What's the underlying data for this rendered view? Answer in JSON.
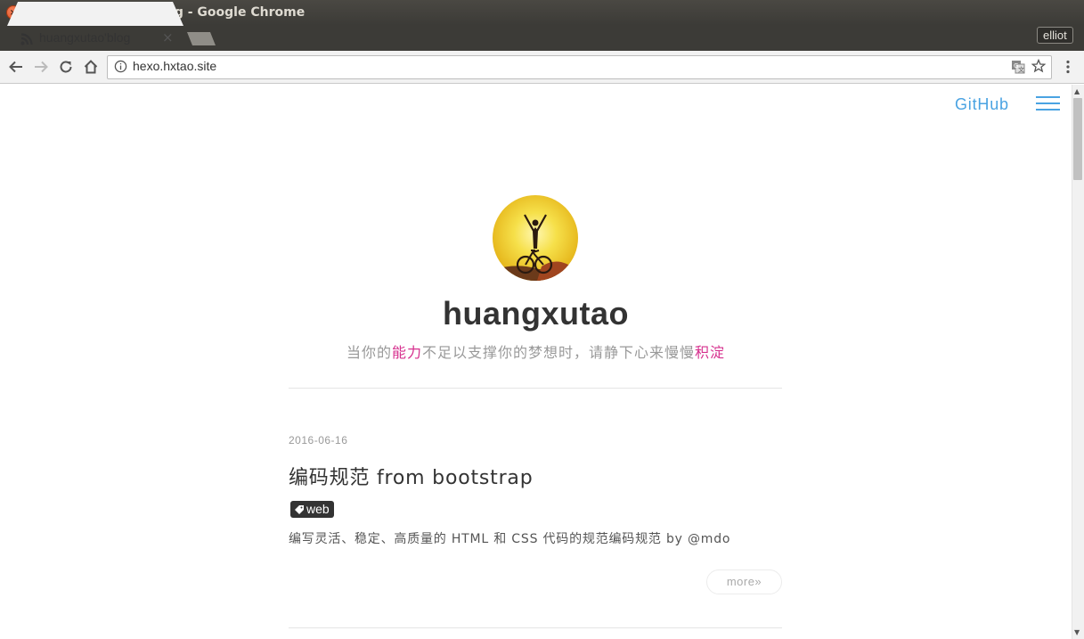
{
  "window": {
    "title": "huangxutao'blog - Google Chrome"
  },
  "tab": {
    "title": "huangxutao'blog",
    "close_glyph": "×"
  },
  "profile": {
    "name": "elliot"
  },
  "omnibox": {
    "url": "hexo.hxtao.site"
  },
  "site": {
    "nav_github": "GitHub",
    "title": "huangxutao",
    "motto_parts": {
      "p1": "当你的",
      "hl1": "能力",
      "p2": "不足以支撑你的梦想时，请静下心来慢慢",
      "hl2": "积淀"
    },
    "highlight_color": "#d6308e",
    "link_color": "#4aa3e2"
  },
  "post": {
    "date": "2016-06-16",
    "title": "编码规范 from bootstrap",
    "tag": "web",
    "excerpt": "编写灵活、稳定、高质量的 HTML 和 CSS 代码的规范编码规范 by @mdo",
    "more_label": "more»"
  },
  "icons": {
    "tab_favicon": "rss-icon",
    "back": "arrow-left-icon",
    "forward": "arrow-right-icon",
    "reload": "reload-icon",
    "home": "home-icon",
    "info": "info-icon",
    "translate": "translate-icon",
    "bookmark": "star-icon",
    "menu": "more-vert-icon",
    "nav_menu": "hamburger-icon",
    "tag": "tag-icon"
  }
}
